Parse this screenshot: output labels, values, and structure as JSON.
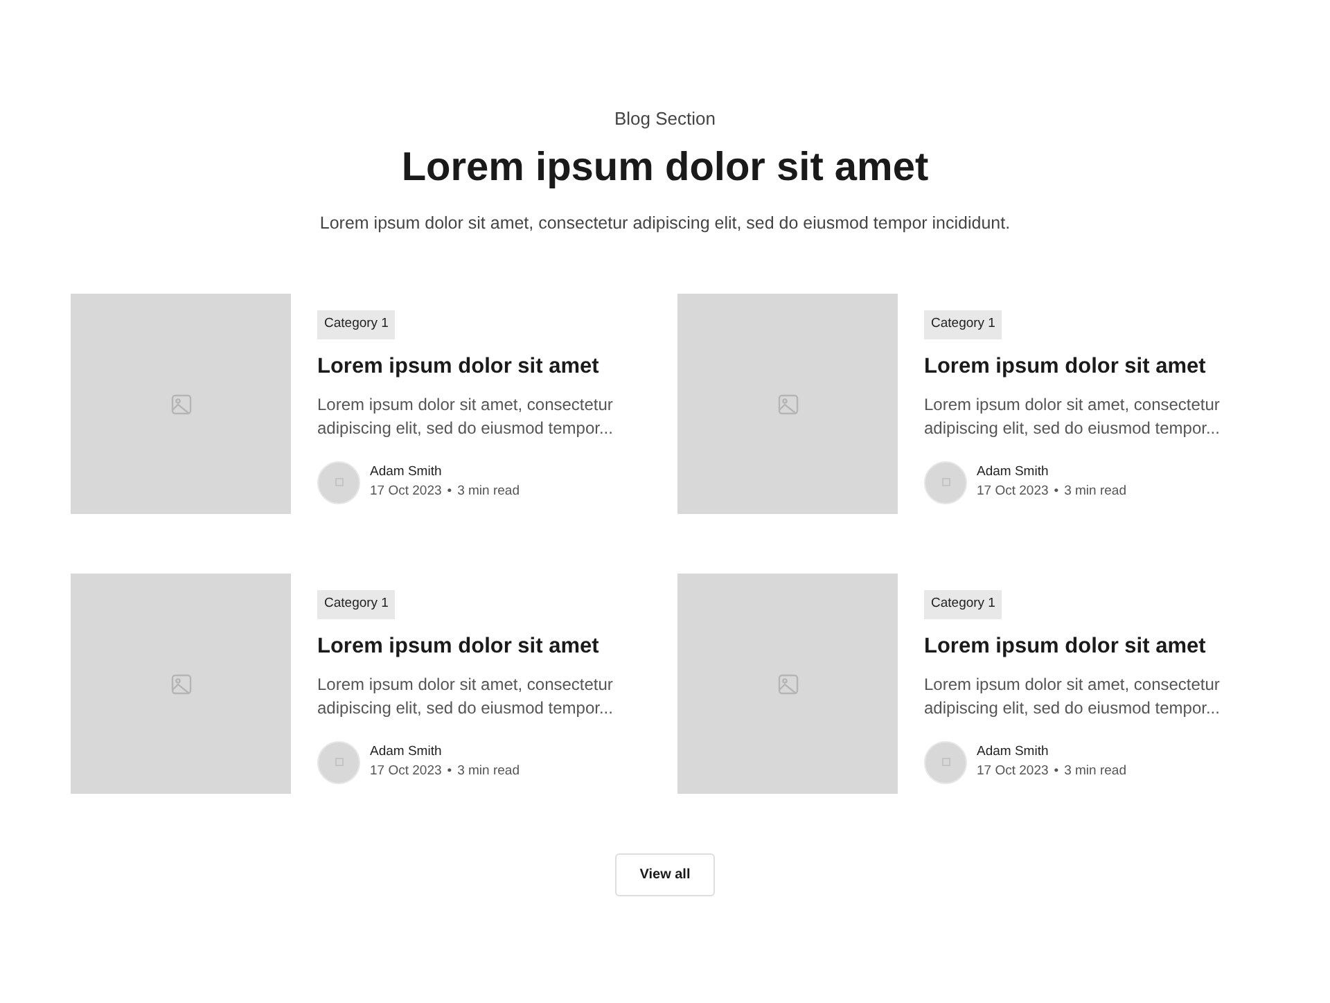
{
  "header": {
    "eyebrow": "Blog Section",
    "title": "Lorem ipsum dolor sit amet",
    "subtitle": "Lorem ipsum dolor sit amet, consectetur adipiscing elit, sed do eiusmod tempor incididunt."
  },
  "posts": [
    {
      "category": "Category 1",
      "title": "Lorem ipsum dolor sit amet",
      "excerpt": "Lorem ipsum dolor sit amet, consectetur adipiscing elit, sed do eiusmod tempor...",
      "author": "Adam Smith",
      "date": "17 Oct 2023",
      "separator": "•",
      "read_time": "3 min read"
    },
    {
      "category": "Category 1",
      "title": "Lorem ipsum dolor sit amet",
      "excerpt": "Lorem ipsum dolor sit amet, consectetur adipiscing elit, sed do eiusmod tempor...",
      "author": "Adam Smith",
      "date": "17 Oct 2023",
      "separator": "•",
      "read_time": "3 min read"
    },
    {
      "category": "Category 1",
      "title": "Lorem ipsum dolor sit amet",
      "excerpt": "Lorem ipsum dolor sit amet, consectetur adipiscing elit, sed do eiusmod tempor...",
      "author": "Adam Smith",
      "date": "17 Oct 2023",
      "separator": "•",
      "read_time": "3 min read"
    },
    {
      "category": "Category 1",
      "title": "Lorem ipsum dolor sit amet",
      "excerpt": "Lorem ipsum dolor sit amet, consectetur adipiscing elit, sed do eiusmod tempor...",
      "author": "Adam Smith",
      "date": "17 Oct 2023",
      "separator": "•",
      "read_time": "3 min read"
    }
  ],
  "button": {
    "label": "View all"
  }
}
